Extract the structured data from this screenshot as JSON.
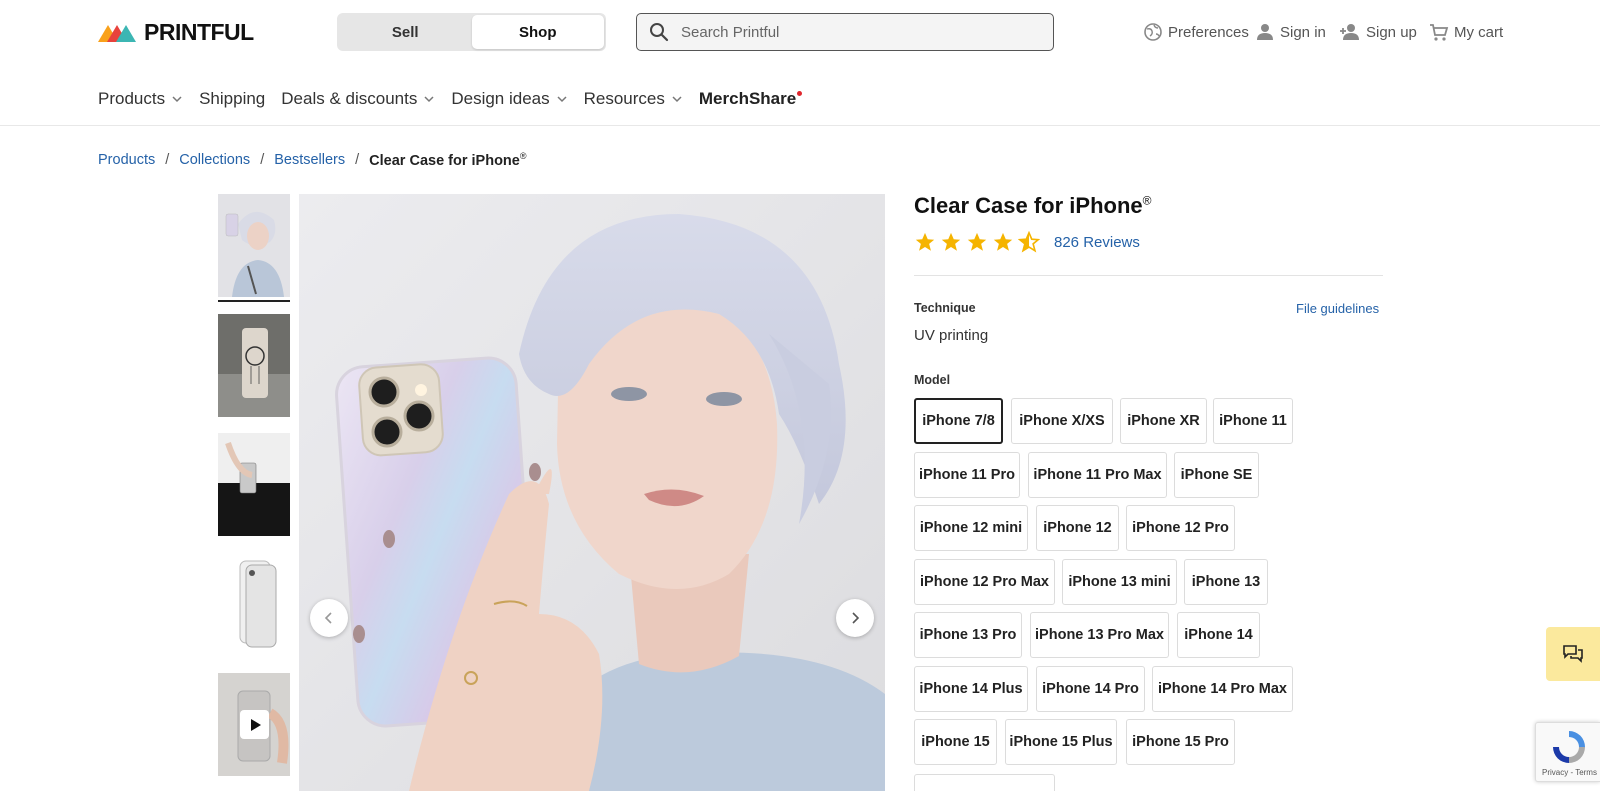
{
  "header": {
    "logo_text": "PRINTFUL",
    "segments": [
      {
        "label": "Sell",
        "active": false
      },
      {
        "label": "Shop",
        "active": true
      }
    ],
    "search_placeholder": "Search Printful",
    "utility": {
      "preferences": "Preferences",
      "sign_in": "Sign in",
      "sign_up": "Sign up",
      "cart": "My cart"
    }
  },
  "nav": {
    "products": "Products",
    "shipping": "Shipping",
    "deals": "Deals & discounts",
    "design_ideas": "Design ideas",
    "resources": "Resources",
    "merchshare": "MerchShare"
  },
  "breadcrumb": {
    "items": [
      "Products",
      "Collections",
      "Bestsellers"
    ],
    "current": "Clear Case for iPhone",
    "current_mark": "®"
  },
  "product": {
    "title": "Clear Case for iPhone",
    "title_mark": "®",
    "rating": 4.5,
    "reviews": "826 Reviews",
    "technique_label": "Technique",
    "technique_value": "UV printing",
    "file_guidelines": "File guidelines",
    "model_label": "Model",
    "selected_model": "iPhone 7/8",
    "models": [
      [
        "iPhone 7/8",
        "iPhone X/XS",
        "iPhone XR",
        "iPhone 11"
      ],
      [
        "iPhone 11 Pro",
        "iPhone 11 Pro Max",
        "iPhone SE"
      ],
      [
        "iPhone 12 mini",
        "iPhone 12",
        "iPhone 12 Pro"
      ],
      [
        "iPhone 12 Pro Max",
        "iPhone 13 mini",
        "iPhone 13"
      ],
      [
        "iPhone 13 Pro",
        "iPhone 13 Pro Max",
        "iPhone 14"
      ],
      [
        "iPhone 14 Plus",
        "iPhone 14 Pro",
        "iPhone 14 Pro Max"
      ],
      [
        "iPhone 15",
        "iPhone 15 Plus",
        "iPhone 15 Pro"
      ]
    ]
  },
  "recaptcha": {
    "text": "Privacy - Terms"
  },
  "colors": {
    "link": "#2562a8",
    "star": "#f5b400",
    "chat_bg": "#fbe99d",
    "notification_dot": "#e0262d"
  }
}
